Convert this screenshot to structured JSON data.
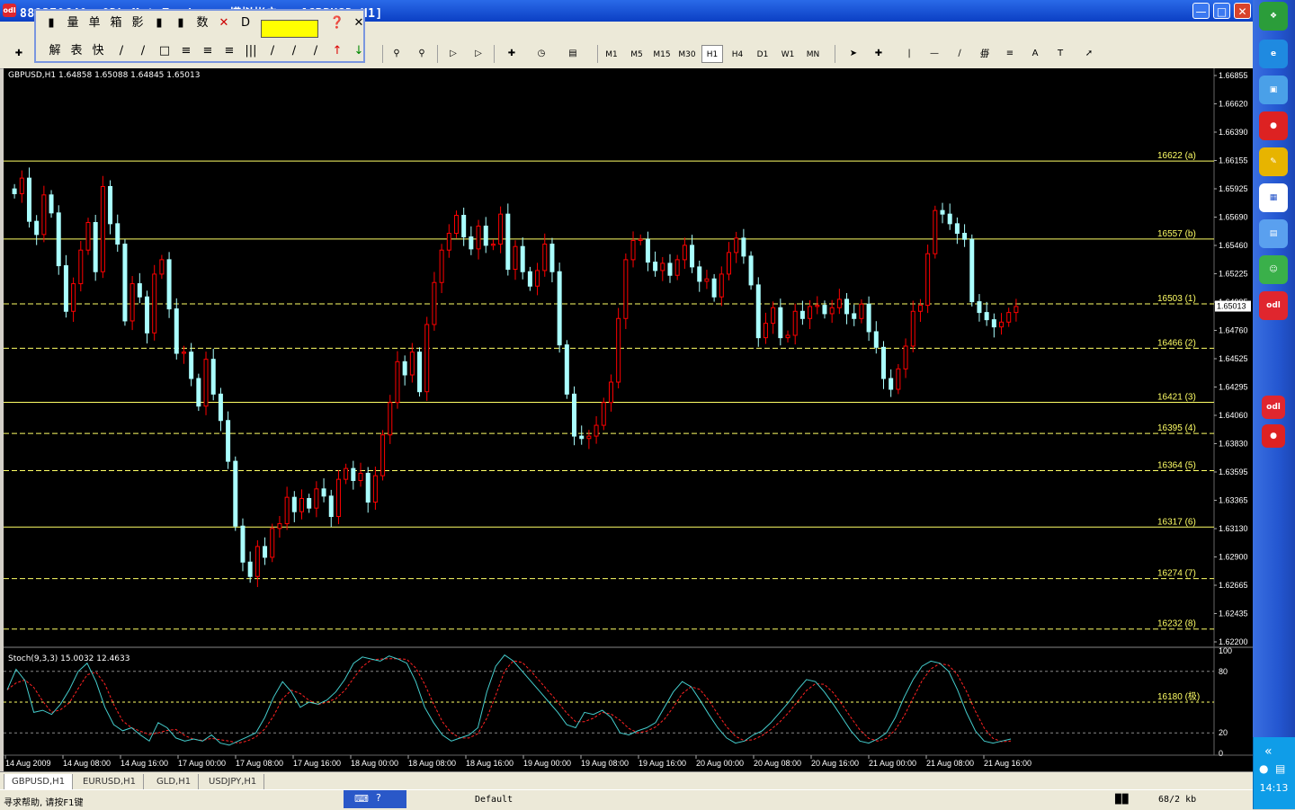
{
  "window": {
    "title": "889370640: ODL MetaTrader - 模拟帐户 - [GBPUSD,H1]",
    "app_icon": "odl",
    "controls": [
      "minimize-icon",
      "maximize-icon",
      "close-icon"
    ]
  },
  "toolbar": {
    "timeframes": [
      "M1",
      "M5",
      "M15",
      "M30",
      "H1",
      "H4",
      "D1",
      "W1",
      "MN"
    ],
    "active_timeframe": "H1"
  },
  "drawing_toolbar": {
    "row1": [
      "量",
      "单",
      "箱",
      "影",
      "数"
    ],
    "row2": [
      "解",
      "表",
      "快"
    ],
    "color": "#ffff00"
  },
  "chart": {
    "symbol_header": "GBPUSD,H1  1.64858 1.65088 1.64845 1.65013",
    "current_price": "1.65013",
    "price_axis": [
      "1.66855",
      "1.66620",
      "1.66390",
      "1.66155",
      "1.65925",
      "1.65690",
      "1.65460",
      "1.65225",
      "1.64995",
      "1.64760",
      "1.64525",
      "1.64295",
      "1.64060",
      "1.63830",
      "1.63595",
      "1.63365",
      "1.63130",
      "1.62900",
      "1.62665",
      "1.62435",
      "1.62200"
    ],
    "levels": [
      {
        "label": "16622 (a)",
        "price": 1.66222,
        "style": "solid"
      },
      {
        "label": "16557 (b)",
        "price": 1.65572,
        "style": "solid"
      },
      {
        "label": "16503 (1)",
        "price": 1.65032,
        "style": "dashed"
      },
      {
        "label": "16466 (2)",
        "price": 1.64662,
        "style": "dashed"
      },
      {
        "label": "16421 (3)",
        "price": 1.64212,
        "style": "solid"
      },
      {
        "label": "16395 (4)",
        "price": 1.63952,
        "style": "dashed"
      },
      {
        "label": "16364 (5)",
        "price": 1.63642,
        "style": "dashed"
      },
      {
        "label": "16317 (6)",
        "price": 1.63172,
        "style": "solid"
      },
      {
        "label": "16274 (7)",
        "price": 1.62742,
        "style": "dashed"
      },
      {
        "label": "16232 (8)",
        "price": 1.62322,
        "style": "dashed"
      }
    ],
    "stoch_header": "Stoch(9,3,3) 15.0032 12.4633",
    "stoch_axis": [
      "100",
      "80",
      "20",
      "0"
    ],
    "stoch_level_label": "16180 (极)",
    "time_axis": [
      "14 Aug 2009",
      "14 Aug 08:00",
      "14 Aug 16:00",
      "17 Aug 00:00",
      "17 Aug 08:00",
      "17 Aug 16:00",
      "18 Aug 00:00",
      "18 Aug 08:00",
      "18 Aug 16:00",
      "19 Aug 00:00",
      "19 Aug 08:00",
      "19 Aug 16:00",
      "20 Aug 00:00",
      "20 Aug 08:00",
      "20 Aug 16:00",
      "21 Aug 00:00",
      "21 Aug 08:00",
      "21 Aug 16:00"
    ]
  },
  "chart_data": {
    "type": "candlestick",
    "ylim": [
      1.622,
      1.6695
    ],
    "closes": [
      1.6595,
      1.6608,
      1.6572,
      1.6561,
      1.6594,
      1.6579,
      1.6535,
      1.6497,
      1.652,
      1.6548,
      1.6571,
      1.653,
      1.6601,
      1.657,
      1.6553,
      1.6489,
      1.652,
      1.6509,
      1.6479,
      1.6528,
      1.654,
      1.6499,
      1.6462,
      1.6463,
      1.6441,
      1.6418,
      1.6457,
      1.6428,
      1.6406,
      1.6372,
      1.6318,
      1.6288,
      1.6276,
      1.6301,
      1.6292,
      1.6316,
      1.632,
      1.6342,
      1.633,
      1.6341,
      1.6333,
      1.6349,
      1.6343,
      1.6326,
      1.6357,
      1.6366,
      1.6356,
      1.6362,
      1.6338,
      1.636,
      1.6394,
      1.6421,
      1.6455,
      1.6444,
      1.6463,
      1.643,
      1.6486,
      1.6521,
      1.6548,
      1.6562,
      1.6577,
      1.6559,
      1.6549,
      1.6568,
      1.6552,
      1.6553,
      1.6578,
      1.6532,
      1.6551,
      1.653,
      1.6518,
      1.6531,
      1.6553,
      1.653,
      1.6469,
      1.6428,
      1.6393,
      1.6391,
      1.6393,
      1.6402,
      1.6421,
      1.6438,
      1.6491,
      1.654,
      1.6556,
      1.6557,
      1.6538,
      1.6531,
      1.6537,
      1.6527,
      1.654,
      1.6552,
      1.6534,
      1.6522,
      1.6524,
      1.6509,
      1.6528,
      1.6546,
      1.6558,
      1.6543,
      1.6519,
      1.6475,
      1.6487,
      1.65,
      1.6475,
      1.6477,
      1.6497,
      1.6491,
      1.6501,
      1.6502,
      1.6495,
      1.65,
      1.6507,
      1.6495,
      1.6491,
      1.6503,
      1.648,
      1.6467,
      1.6441,
      1.6432,
      1.6449,
      1.6468,
      1.6497,
      1.6502,
      1.6545,
      1.6581,
      1.6578,
      1.657,
      1.6562,
      1.6557,
      1.6505,
      1.6496,
      1.649,
      1.6484,
      1.6488,
      1.6496,
      1.6501
    ],
    "stoch_k": [
      62,
      82,
      71,
      40,
      42,
      38,
      48,
      62,
      80,
      88,
      70,
      45,
      28,
      22,
      25,
      18,
      12,
      30,
      25,
      15,
      12,
      14,
      12,
      18,
      10,
      8,
      12,
      16,
      20,
      35,
      55,
      70,
      60,
      45,
      50,
      48,
      52,
      60,
      72,
      88,
      94,
      92,
      90,
      95,
      92,
      88,
      70,
      45,
      30,
      18,
      12,
      15,
      18,
      25,
      60,
      85,
      96,
      90,
      80,
      70,
      60,
      50,
      40,
      28,
      25,
      40,
      38,
      42,
      35,
      20,
      18,
      22,
      25,
      30,
      45,
      60,
      70,
      65,
      52,
      38,
      25,
      15,
      10,
      12,
      18,
      22,
      30,
      40,
      50,
      62,
      72,
      70,
      60,
      48,
      35,
      22,
      12,
      10,
      14,
      20,
      35,
      55,
      72,
      85,
      90,
      88,
      80,
      62,
      40,
      22,
      12,
      10,
      12,
      14
    ]
  },
  "tabs": [
    "GBPUSD,H1",
    "EURUSD,H1",
    "GLD,H1",
    "USDJPY,H1"
  ],
  "active_tab": "GBPUSD,H1",
  "status": {
    "help": "寻求帮助, 请按F1键",
    "profile": "Default",
    "traffic": "68/2 kb"
  },
  "taskbar": {
    "clock": "14:13",
    "icons": [
      "windows-logo-icon",
      "ie-icon",
      "app-icon-1",
      "odl-red-icon",
      "paint-icon",
      "checker-icon",
      "calendar-icon",
      "users-icon",
      "odl-icon",
      "odl-small-icon",
      "red-app-icon"
    ]
  },
  "colors": {
    "chart_bg": "#000000",
    "bull_candle": "#ff0000",
    "bear_candle": "#aaffff",
    "level_line": "#ffff66",
    "stoch_main": "#44cccc",
    "stoch_signal": "#ff2222"
  }
}
